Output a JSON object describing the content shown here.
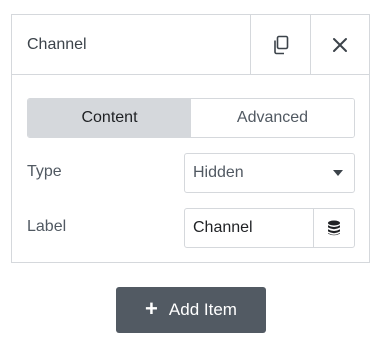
{
  "panel": {
    "title": "Channel",
    "duplicate_icon": "duplicate-icon",
    "close_icon": "close-icon"
  },
  "tabs": [
    {
      "label": "Content",
      "active": true
    },
    {
      "label": "Advanced",
      "active": false
    }
  ],
  "fields": {
    "type": {
      "label": "Type",
      "selected": "Hidden",
      "icon": "chevron-down-icon"
    },
    "label": {
      "label": "Label",
      "value": "Channel",
      "dynamic_icon": "database-icon"
    }
  },
  "add_button": {
    "label": "Add Item",
    "icon": "plus-icon"
  },
  "colors": {
    "border": "#d5d8dc",
    "active_tab": "#d5d8dc",
    "add_button_bg": "#525a63",
    "text": "#515962"
  }
}
